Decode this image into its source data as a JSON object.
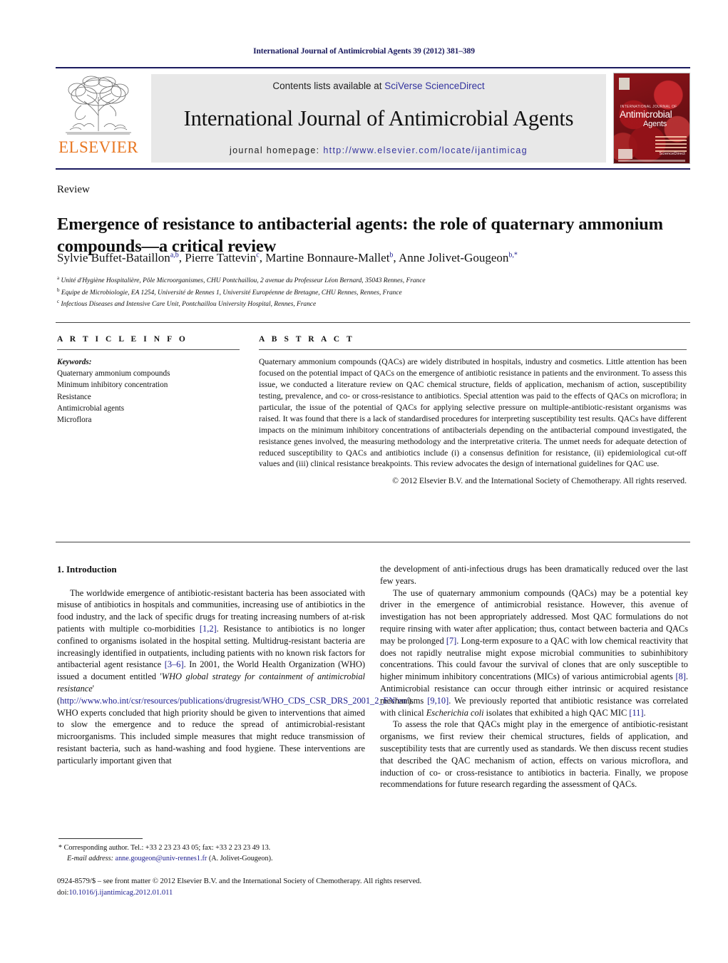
{
  "running_head": "International Journal of Antimicrobial Agents 39 (2012) 381–389",
  "masthead": {
    "publisher_name": "ELSEVIER",
    "contents_prefix": "Contents lists available at ",
    "contents_link": "SciVerse ScienceDirect",
    "journal_title": "International Journal of Antimicrobial Agents",
    "homepage_prefix": "journal homepage: ",
    "homepage_link": "http://www.elsevier.com/locate/ijantimicag",
    "cover": {
      "kicker": "INTERNATIONAL JOURNAL OF",
      "line1": "Antimicrobial",
      "line2": "Agents",
      "society": "ScienceDirect"
    }
  },
  "article": {
    "doctype": "Review",
    "title": "Emergence of resistance to antibacterial agents: the role of quaternary ammonium compounds—a critical review",
    "authors_html": "Sylvie Buffet-Bataillon<sup>a,b</sup>, Pierre Tattevin<sup>c</sup>, Martine Bonnaure-Mallet<sup>b</sup>, Anne Jolivet-Gougeon<sup>b,*</sup>",
    "affiliations": [
      "Unité d'Hygiène Hospitalière, Pôle Microorganismes, CHU Pontchaillou, 2 avenue du Professeur Léon Bernard, 35043 Rennes, France",
      "Equipe de Microbiologie, EA 1254, Université de Rennes 1, Université Européenne de Bretagne, CHU Rennes, Rennes, France",
      "Infectious Diseases and Intensive Care Unit, Pontchaillou University Hospital, Rennes, France"
    ],
    "affiliation_marks": [
      "a",
      "b",
      "c"
    ]
  },
  "article_info": {
    "heading": "A R T I C L E    I N F O",
    "keywords_label": "Keywords:",
    "keywords": [
      "Quaternary ammonium compounds",
      "Minimum inhibitory concentration",
      "Resistance",
      "Antimicrobial agents",
      "Microflora"
    ]
  },
  "abstract": {
    "heading": "A B S T R A C T",
    "text": "Quaternary ammonium compounds (QACs) are widely distributed in hospitals, industry and cosmetics. Little attention has been focused on the potential impact of QACs on the emergence of antibiotic resistance in patients and the environment. To assess this issue, we conducted a literature review on QAC chemical structure, fields of application, mechanism of action, susceptibility testing, prevalence, and co- or cross-resistance to antibiotics. Special attention was paid to the effects of QACs on microflora; in particular, the issue of the potential of QACs for applying selective pressure on multiple-antibiotic-resistant organisms was raised. It was found that there is a lack of standardised procedures for interpreting susceptibility test results. QACs have different impacts on the minimum inhibitory concentrations of antibacterials depending on the antibacterial compound investigated, the resistance genes involved, the measuring methodology and the interpretative criteria. The unmet needs for adequate detection of reduced susceptibility to QACs and antibiotics include (i) a consensus definition for resistance, (ii) epidemiological cut-off values and (iii) clinical resistance breakpoints. This review advocates the design of international guidelines for QAC use.",
    "copyright": "© 2012 Elsevier B.V. and the International Society of Chemotherapy. All rights reserved."
  },
  "body": {
    "section_heading": "1.  Introduction",
    "left_p1_html": "The worldwide emergence of antibiotic-resistant bacteria has been associated with misuse of antibiotics in hospitals and communities, increasing use of antibiotics in the food industry, and the lack of specific drugs for treating increasing numbers of at-risk patients with multiple co-morbidities <span class=\"ref\">[1,2]</span>. Resistance to antibiotics is no longer confined to organisms isolated in the hospital setting. Multidrug-resistant bacteria are increasingly identified in outpatients, including patients with no known risk factors for antibacterial agent resistance <span class=\"ref\">[3–6]</span>. In 2001, the World Health Organization (WHO) issued a document entitled '<span class=\"ital\">WHO global strategy for containment of antimicrobial resistance</span>' (<span class=\"url\">http://www.who.int/csr/resources/publications/drugresist/WHO_CDS_CSR_DRS_2001_2_EN/en/</span>). WHO experts concluded that high priority should be given to interventions that aimed to slow the emergence and to reduce the spread of antimicrobial-resistant microorganisms. This included simple measures that might reduce transmission of resistant bacteria, such as hand-washing and food hygiene. These interventions are particularly important given that",
    "right_p1_html": "the development of anti-infectious drugs has been dramatically reduced over the last few years.",
    "right_p2_html": "The use of quaternary ammonium compounds (QACs) may be a potential key driver in the emergence of antimicrobial resistance. However, this avenue of investigation has not been appropriately addressed. Most QAC formulations do not require rinsing with water after application; thus, contact between bacteria and QACs may be prolonged <span class=\"ref\">[7]</span>. Long-term exposure to a QAC with low chemical reactivity that does not rapidly neutralise might expose microbial communities to subinhibitory concentrations. This could favour the survival of clones that are only susceptible to higher minimum inhibitory concentrations (MICs) of various antimicrobial agents <span class=\"ref\">[8]</span>. Antimicrobial resistance can occur through either intrinsic or acquired resistance mechanisms <span class=\"ref\">[9,10]</span>. We previously reported that antibiotic resistance was correlated with clinical <span class=\"ital\">Escherichia coli</span> isolates that exhibited a high QAC MIC <span class=\"ref\">[11]</span>.",
    "right_p3_html": "To assess the role that QACs might play in the emergence of antibiotic-resistant organisms, we first review their chemical structures, fields of application, and susceptibility tests that are currently used as standards. We then discuss recent studies that described the QAC mechanism of action, effects on various microflora, and induction of co- or cross-resistance to antibiotics in bacteria. Finally, we propose recommendations for future research regarding the assessment of QACs."
  },
  "footnote": {
    "corresponding_html": "* Corresponding author. Tel.: +33 2 23 23 43 05; fax: +33 2 23 23 49 13.",
    "email_html": "<span class=\"fn-ital\">E-mail address:</span> <span class=\"mail\">anne.gougeon@univ-rennes1.fr</span> (A. Jolivet-Gougeon)."
  },
  "colophon": {
    "line1": "0924-8579/$ – see front matter © 2012 Elsevier B.V. and the International Society of Chemotherapy. All rights reserved.",
    "doi_prefix": "doi:",
    "doi": "10.1016/j.ijantimicag.2012.01.011"
  }
}
